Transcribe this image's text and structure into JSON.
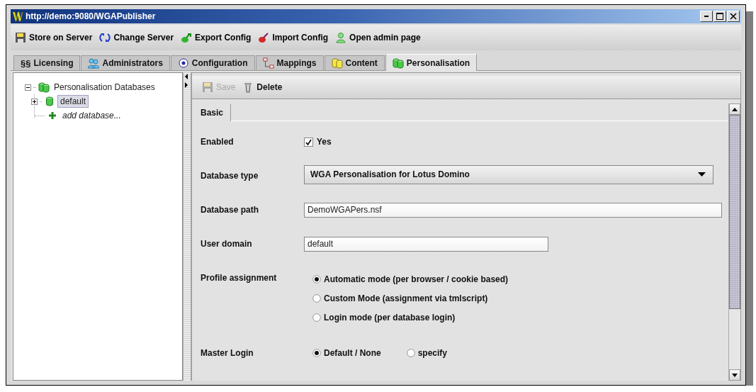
{
  "window": {
    "title": "http://demo:9080/WGAPublisher"
  },
  "toolbar": [
    {
      "label": "Store on Server"
    },
    {
      "label": "Change Server"
    },
    {
      "label": "Export Config"
    },
    {
      "label": "Import Config"
    },
    {
      "label": "Open admin page"
    }
  ],
  "tabs": [
    {
      "symbol": "§§",
      "label": "Licensing",
      "selected": false
    },
    {
      "label": "Administrators",
      "selected": false
    },
    {
      "label": "Configuration",
      "selected": false
    },
    {
      "label": "Mappings",
      "selected": false
    },
    {
      "label": "Content",
      "selected": false
    },
    {
      "label": "Personalisation",
      "selected": true
    }
  ],
  "tree": {
    "label": "Personalisation Databases",
    "expanded": true,
    "selected": false,
    "children": [
      {
        "kind": "database",
        "label": "default",
        "expanded": false,
        "selected": true
      },
      {
        "kind": "action",
        "label": "add database...",
        "selected": false
      }
    ]
  },
  "editor_toolbar": [
    {
      "label": "Save",
      "disabled": true
    },
    {
      "label": "Delete",
      "disabled": false
    }
  ],
  "editor_tabs": [
    {
      "label": "Basic",
      "selected": true
    }
  ],
  "form": {
    "enabled": {
      "label": "Enabled",
      "option": "Yes",
      "checked": true
    },
    "database_type": {
      "label": "Database type",
      "value": "WGA Personalisation for Lotus Domino"
    },
    "database_path": {
      "label": "Database path",
      "value": "DemoWGAPers.nsf"
    },
    "user_domain": {
      "label": "User domain",
      "value": "default"
    },
    "profile_assignment": {
      "label": "Profile assignment",
      "options": [
        {
          "label": "Automatic mode (per browser / cookie based)",
          "selected": true
        },
        {
          "label": "Custom Mode (assignment via tmlscript)",
          "selected": false
        },
        {
          "label": "Login mode (per database login)",
          "selected": false
        }
      ]
    },
    "master_login": {
      "label": "Master Login",
      "options": [
        {
          "label": "Default / None",
          "selected": true
        },
        {
          "label": "specify",
          "selected": false
        }
      ]
    }
  }
}
